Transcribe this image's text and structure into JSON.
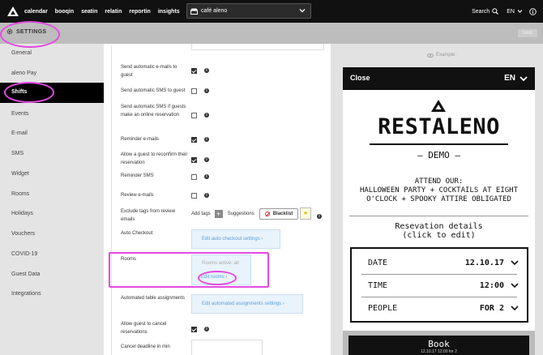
{
  "nav": {
    "items": [
      "calendar",
      "booqin",
      "seatin",
      "relatin",
      "reportin",
      "insights"
    ],
    "venue": "café aleno",
    "search_label": "Search",
    "language": "EN"
  },
  "settings": {
    "title": "SETTINGS",
    "save_label": "SAVE"
  },
  "sidebar": {
    "items": [
      "General",
      "aleno Pay",
      "Shifts",
      "Events",
      "E-mail",
      "SMS",
      "Widget",
      "Rooms",
      "Holidays",
      "Vouchers",
      "COVID-19",
      "Guest Data",
      "Integrations"
    ],
    "active": "Shifts"
  },
  "main": {
    "rows": [
      {
        "label": "Send automatic e-mails to guest",
        "checked": true
      },
      {
        "label": "Send automatic SMS to guest",
        "checked": false
      },
      {
        "label": "Send automatic SMS if guests make an online reservation",
        "checked": false
      },
      {
        "label": "Reminder e-mails",
        "checked": true
      },
      {
        "label": "Allow a guest to reconfirm their reservation",
        "checked": true
      },
      {
        "label": "Reminder SMS",
        "checked": false
      },
      {
        "label": "Review e-mails",
        "checked": false
      }
    ],
    "exclude_tags_label": "Exclude tags from review emails",
    "add_tags_label": "Add tags",
    "suggestions_label": "Suggestions",
    "blacklist_label": "Blacklist",
    "auto_checkout_label": "Auto Checkout",
    "auto_checkout_link": "Edit auto checkout settings",
    "rooms_label": "Rooms",
    "rooms_active": "Rooms active: all",
    "edit_rooms_link": "Edit rooms",
    "automated_table_label": "Automated table assignments",
    "automated_link": "Edit automated assignments settings",
    "allow_cancel_label": "Allow guest to cancel reservations",
    "allow_cancel_checked": true,
    "cancel_deadline_label": "Cancel deadline in min"
  },
  "preview": {
    "example_label": "Example:",
    "close_label": "Close",
    "language": "EN",
    "brand": "RESTALENO",
    "demo": "– DEMO –",
    "attend_lines": [
      "ATTEND OUR:",
      "HALLOWEEN PARTY + COCKTAILS AT EIGHT",
      "O'CLOCK + SPOOKY ATTIRE OBLIGATED"
    ],
    "res_title_lines": [
      "Resevation details",
      "(click to edit)"
    ],
    "details": [
      {
        "label": "DATE",
        "value": "12.10.17"
      },
      {
        "label": "TIME",
        "value": "12:00"
      },
      {
        "label": "PEOPLE",
        "value": "FOR 2"
      }
    ],
    "book_label": "Book",
    "book_sub": "12.10.17 12:00 for 2"
  },
  "colors": {
    "accent": "#111111",
    "link": "#5aa0d8",
    "annotation": "#e34be0"
  }
}
